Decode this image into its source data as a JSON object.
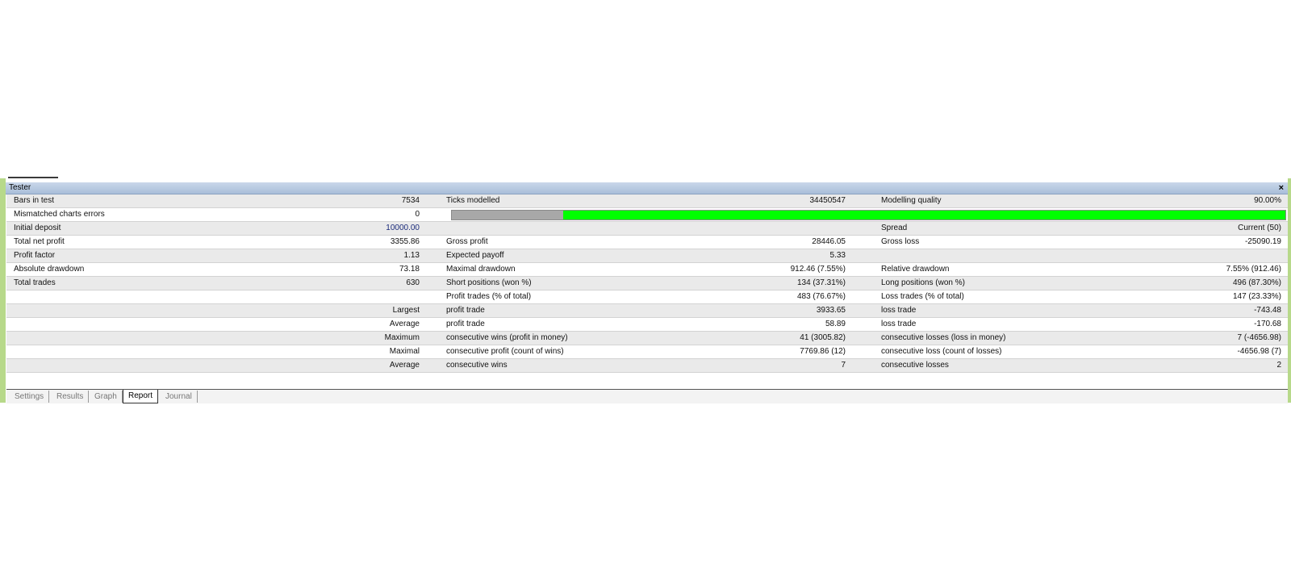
{
  "window": {
    "title": "Tester",
    "close": "×"
  },
  "report": {
    "bars_in_test": {
      "label": "Bars in test",
      "value": "7534"
    },
    "ticks_modelled": {
      "label": "Ticks modelled",
      "value": "34450547"
    },
    "modelling_quality": {
      "label": "Modelling quality",
      "value": "90.00%"
    },
    "mismatched": {
      "label": "Mismatched charts errors",
      "value": "0"
    },
    "quality_bar": {
      "gray_fraction": 0.134,
      "gray_color": "#a8a8a8",
      "fill_color": "#00ff00"
    },
    "initial_deposit": {
      "label": "Initial deposit",
      "value": "10000.00"
    },
    "spread": {
      "label": "Spread",
      "value": "Current (50)"
    },
    "total_net_profit": {
      "label": "Total net profit",
      "value": "3355.86"
    },
    "gross_profit": {
      "label": "Gross profit",
      "value": "28446.05"
    },
    "gross_loss": {
      "label": "Gross loss",
      "value": "-25090.19"
    },
    "profit_factor": {
      "label": "Profit factor",
      "value": "1.13"
    },
    "expected_payoff": {
      "label": "Expected payoff",
      "value": "5.33"
    },
    "absolute_drawdown": {
      "label": "Absolute drawdown",
      "value": "73.18"
    },
    "maximal_drawdown": {
      "label": "Maximal drawdown",
      "value": "912.46 (7.55%)"
    },
    "relative_drawdown": {
      "label": "Relative drawdown",
      "value": "7.55% (912.46)"
    },
    "total_trades": {
      "label": "Total trades",
      "value": "630"
    },
    "short_positions": {
      "label": "Short positions (won %)",
      "value": "134 (37.31%)"
    },
    "long_positions": {
      "label": "Long positions (won %)",
      "value": "496 (87.30%)"
    },
    "profit_trades": {
      "label": "Profit trades (% of total)",
      "value": "483 (76.67%)"
    },
    "loss_trades": {
      "label": "Loss trades (% of total)",
      "value": "147 (23.33%)"
    },
    "largest": {
      "prefix": "Largest",
      "profit_label": "profit trade",
      "profit_value": "3933.65",
      "loss_label": "loss trade",
      "loss_value": "-743.48"
    },
    "average": {
      "prefix": "Average",
      "profit_label": "profit trade",
      "profit_value": "58.89",
      "loss_label": "loss trade",
      "loss_value": "-170.68"
    },
    "maximum": {
      "prefix": "Maximum",
      "wins_label": "consecutive wins (profit in money)",
      "wins_value": "41 (3005.82)",
      "losses_label": "consecutive losses (loss in money)",
      "losses_value": "7 (-4656.98)"
    },
    "maximal": {
      "prefix": "Maximal",
      "profit_label": "consecutive profit (count of wins)",
      "profit_value": "7769.86 (12)",
      "loss_label": "consecutive loss (count of losses)",
      "loss_value": "-4656.98 (7)"
    },
    "average_consecutive": {
      "prefix": "Average",
      "wins_label": "consecutive wins",
      "wins_value": "7",
      "losses_label": "consecutive losses",
      "losses_value": "2"
    }
  },
  "tabs": [
    {
      "label": "Settings"
    },
    {
      "label": "Results"
    },
    {
      "label": "Graph"
    },
    {
      "label": "Report"
    },
    {
      "label": "Journal"
    }
  ],
  "active_tab": "Report"
}
